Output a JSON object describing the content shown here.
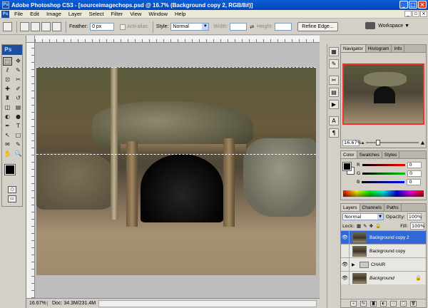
{
  "window": {
    "title": "Adobe Photoshop CS3 - [sourceimagechops.psd @ 16.7% (Background copy 2, RGB/8#)]",
    "app_icon": "Ps"
  },
  "menu": {
    "items": [
      "File",
      "Edit",
      "Image",
      "Layer",
      "Select",
      "Filter",
      "View",
      "Window",
      "Help"
    ]
  },
  "options": {
    "feather_label": "Feather:",
    "feather_value": "0 px",
    "antialias_label": "Anti-alias",
    "style_label": "Style:",
    "style_value": "Normal",
    "width_label": "Width:",
    "height_label": "Height:",
    "refine_label": "Refine Edge...",
    "workspace_label": "Workspace ▼"
  },
  "toolbox": {
    "logo": "Ps",
    "tools": [
      "marquee-tool",
      "move-tool",
      "lasso-tool",
      "quick-select-tool",
      "crop-tool",
      "slice-tool",
      "healing-tool",
      "brush-tool",
      "stamp-tool",
      "history-brush-tool",
      "eraser-tool",
      "gradient-tool",
      "blur-tool",
      "dodge-tool",
      "pen-tool",
      "type-tool",
      "path-select-tool",
      "shape-tool",
      "notes-tool",
      "eyedropper-tool",
      "hand-tool",
      "zoom-tool"
    ],
    "glyphs": [
      "⬚",
      "✥",
      "ℓ",
      "✎",
      "⊡",
      "✂",
      "✚",
      "✐",
      "♜",
      "↺",
      "◫",
      "▤",
      "◐",
      "●",
      "✒",
      "T",
      "↖",
      "□",
      "✉",
      "✎",
      "✋",
      "🔍"
    ],
    "fg_color": "#000000",
    "bg_color": "#ffffff"
  },
  "document": {
    "zoom": "16.67%",
    "info": "Doc: 34.3M/231.4M"
  },
  "navigator": {
    "tabs": [
      "Navigator",
      "Histogram",
      "Info"
    ],
    "zoom": "16.67%"
  },
  "color": {
    "tabs": [
      "Color",
      "Swatches",
      "Styles"
    ],
    "channels": [
      {
        "label": "R",
        "value": "0",
        "color": "#ff0000"
      },
      {
        "label": "G",
        "value": "0",
        "color": "#00c000"
      },
      {
        "label": "B",
        "value": "0",
        "color": "#0000ff"
      }
    ]
  },
  "layers": {
    "tabs": [
      "Layers",
      "Channels",
      "Paths"
    ],
    "blend_mode": "Normal",
    "opacity_label": "Opacity:",
    "opacity_value": "100%",
    "lock_label": "Lock:",
    "fill_label": "Fill:",
    "fill_value": "100%",
    "items": [
      {
        "name": "Background copy 2",
        "visible": true,
        "active": true,
        "type": "image"
      },
      {
        "name": "Background copy",
        "visible": false,
        "active": false,
        "type": "image"
      },
      {
        "name": "CHAIR",
        "visible": true,
        "active": false,
        "type": "folder"
      },
      {
        "name": "Background",
        "visible": true,
        "active": false,
        "type": "image",
        "locked": true
      }
    ]
  }
}
